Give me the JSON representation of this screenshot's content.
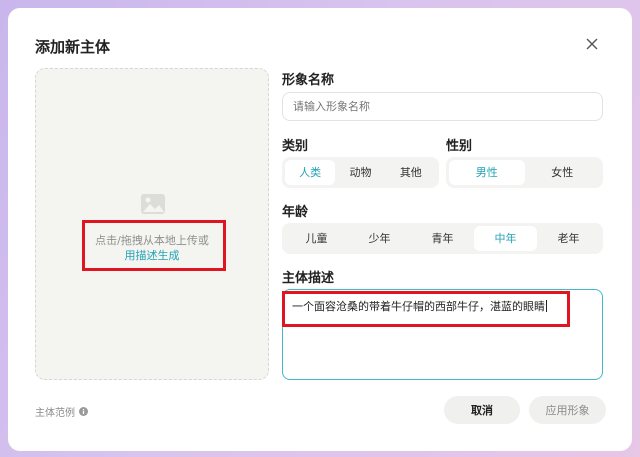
{
  "dialog": {
    "title": "添加新主体",
    "upload": {
      "hint": "点击/拖拽从本地上传或",
      "link": "用描述生成"
    },
    "name_field": {
      "label": "形象名称",
      "placeholder": "请输入形象名称"
    },
    "category": {
      "label": "类别",
      "options": [
        "人类",
        "动物",
        "其他"
      ],
      "selected": "人类"
    },
    "gender": {
      "label": "性别",
      "options": [
        "男性",
        "女性"
      ],
      "selected": "男性"
    },
    "age": {
      "label": "年龄",
      "options": [
        "儿童",
        "少年",
        "青年",
        "中年",
        "老年"
      ],
      "selected": "中年"
    },
    "description": {
      "label": "主体描述",
      "value": "一个面容沧桑的带着牛仔帽的西部牛仔，湛蓝的眼睛"
    },
    "example_link": "主体范例",
    "cancel_label": "取消",
    "apply_label": "应用形象"
  },
  "colors": {
    "accent": "#22a3b6",
    "highlight": "#e01522"
  }
}
